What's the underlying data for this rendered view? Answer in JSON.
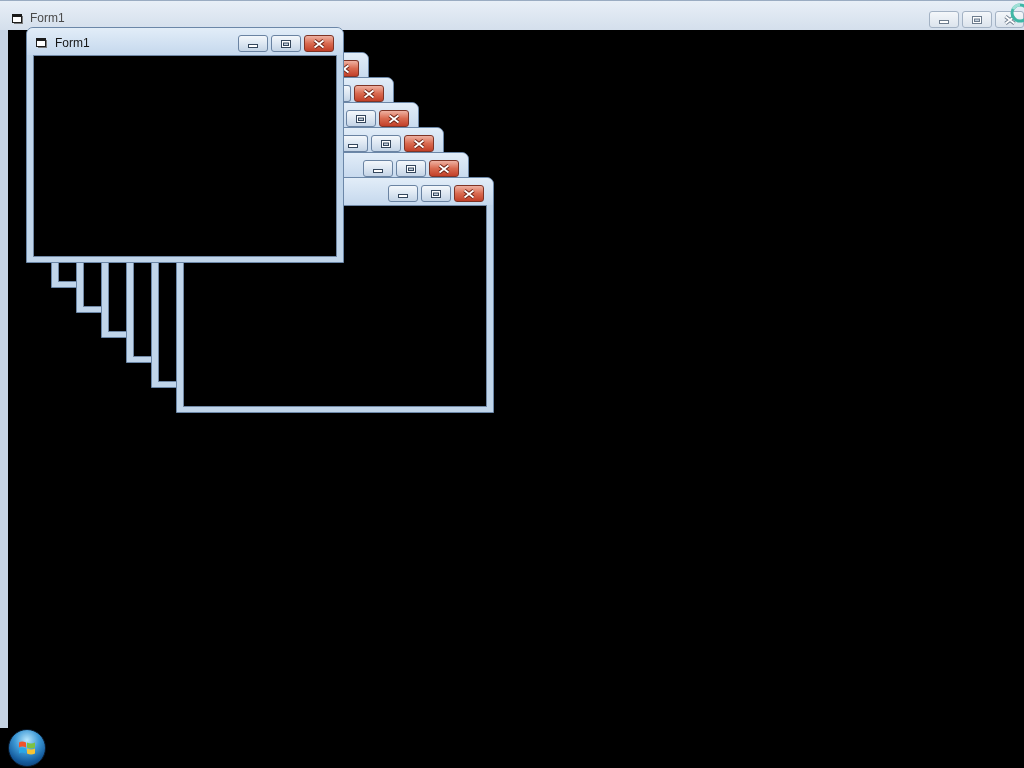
{
  "main_window": {
    "title": "Form1",
    "active": false
  },
  "child_windows": [
    {
      "title": "Form1",
      "active": true
    },
    {
      "active": true
    },
    {
      "active": true
    },
    {
      "active": true
    },
    {
      "active": true
    },
    {
      "active": true
    },
    {
      "active": true
    }
  ]
}
